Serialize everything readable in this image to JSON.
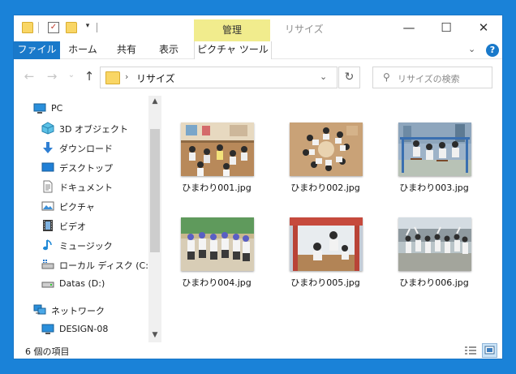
{
  "window": {
    "title": "リサイズ",
    "contextual_group_label": "管理",
    "minimize_glyph": "—",
    "maximize_glyph": "☐",
    "close_glyph": "✕"
  },
  "ribbon": {
    "tabs": [
      "ファイル",
      "ホーム",
      "共有",
      "表示",
      "ピクチャ ツール"
    ],
    "collapse_glyph": "⌄",
    "help_glyph": "?"
  },
  "navbar": {
    "back_glyph": "←",
    "forward_glyph": "→",
    "recent_glyph": "⌄",
    "up_glyph": "↑",
    "breadcrumb_separator": "›",
    "current_folder": "リサイズ",
    "dropdown_glyph": "⌄",
    "refresh_glyph": "↻",
    "search_glyph": "⚲",
    "search_placeholder": "リサイズの検索"
  },
  "nav_pane": {
    "items": [
      {
        "label": "PC",
        "icon": "pc-icon"
      },
      {
        "label": "3D オブジェクト",
        "icon": "3d-objects-icon"
      },
      {
        "label": "ダウンロード",
        "icon": "download-icon"
      },
      {
        "label": "デスクトップ",
        "icon": "desktop-icon"
      },
      {
        "label": "ドキュメント",
        "icon": "document-icon"
      },
      {
        "label": "ピクチャ",
        "icon": "pictures-icon"
      },
      {
        "label": "ビデオ",
        "icon": "video-icon"
      },
      {
        "label": "ミュージック",
        "icon": "music-icon"
      },
      {
        "label": "ローカル ディスク (C:)",
        "icon": "local-disk-icon"
      },
      {
        "label": "Datas (D:)",
        "icon": "drive-icon"
      },
      {
        "label": "ネットワーク",
        "icon": "network-icon"
      },
      {
        "label": "DESIGN-08",
        "icon": "computer-icon"
      }
    ],
    "scroll_up_glyph": "▲",
    "scroll_down_glyph": "▼"
  },
  "files": [
    {
      "name": "ひまわり001.jpg",
      "scene": "classroom"
    },
    {
      "name": "ひまわり002.jpg",
      "scene": "circle"
    },
    {
      "name": "ひまわり003.jpg",
      "scene": "swing"
    },
    {
      "name": "ひまわり004.jpg",
      "scene": "group"
    },
    {
      "name": "ひまわり005.jpg",
      "scene": "playhouse"
    },
    {
      "name": "ひまわり006.jpg",
      "scene": "outdoor"
    }
  ],
  "status": {
    "item_count": "6 個の項目"
  },
  "colors": {
    "accent": "#1979ca",
    "contextual_tab": "#f1ec8d",
    "folder": "#f9d665",
    "desktop_background": "#1a82d8"
  }
}
